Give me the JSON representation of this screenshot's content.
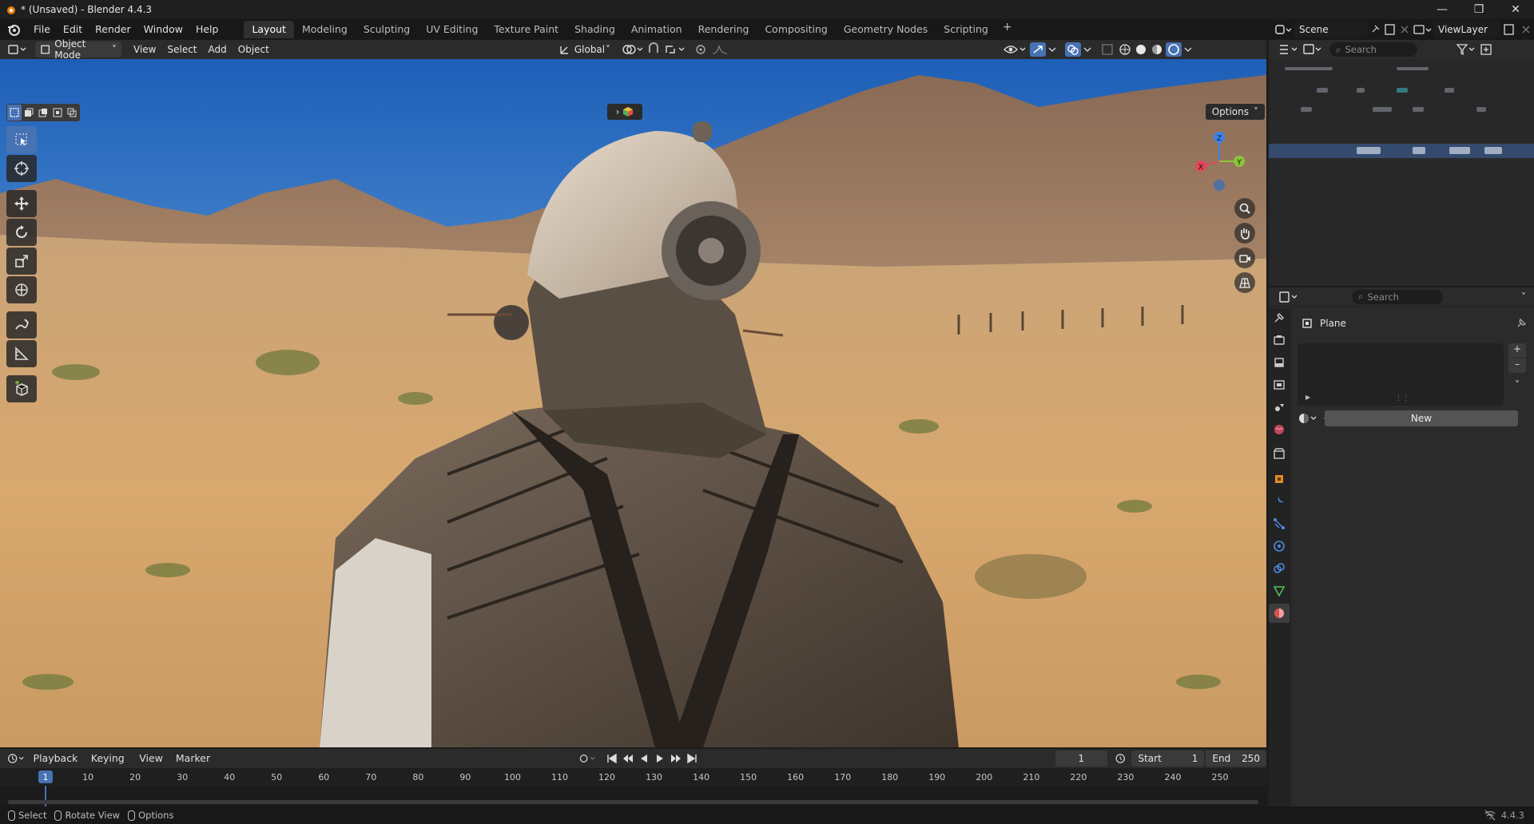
{
  "window": {
    "title": "* (Unsaved) - Blender 4.4.3"
  },
  "menu": {
    "items": [
      "File",
      "Edit",
      "Render",
      "Window",
      "Help"
    ]
  },
  "workspaces": {
    "tabs": [
      "Layout",
      "Modeling",
      "Sculpting",
      "UV Editing",
      "Texture Paint",
      "Shading",
      "Animation",
      "Rendering",
      "Compositing",
      "Geometry Nodes",
      "Scripting"
    ],
    "active": "Layout"
  },
  "scene": {
    "name": "Scene",
    "view_layer": "ViewLayer"
  },
  "viewport_header": {
    "mode": "Object Mode",
    "menus": [
      "View",
      "Select",
      "Add",
      "Object"
    ],
    "orientation": "Global",
    "options_label": "Options"
  },
  "outliner": {
    "search_placeholder": "Search"
  },
  "properties": {
    "search_placeholder": "Search",
    "object_name": "Plane",
    "new_label": "New"
  },
  "timeline": {
    "menus": [
      "Playback",
      "Keying",
      "View",
      "Marker"
    ],
    "current_frame": "1",
    "start_label": "Start",
    "start_value": "1",
    "end_label": "End",
    "end_value": "250",
    "ruler_ticks": [
      "1",
      "10",
      "20",
      "30",
      "40",
      "50",
      "60",
      "70",
      "80",
      "90",
      "100",
      "110",
      "120",
      "130",
      "140",
      "150",
      "160",
      "170",
      "180",
      "190",
      "200",
      "210",
      "220",
      "230",
      "240",
      "250"
    ]
  },
  "statusbar": {
    "hints": [
      "Select",
      "Rotate View",
      "Options"
    ],
    "version": "4.4.3"
  },
  "gizmo": {
    "x_label": "X",
    "y_label": "Y",
    "z_label": "Z"
  },
  "colors": {
    "accent": "#4772b3",
    "gizmo_x": "#e2475a",
    "gizmo_y": "#8bc43a",
    "gizmo_z": "#3b82e8",
    "playhead": "#4772b3"
  }
}
